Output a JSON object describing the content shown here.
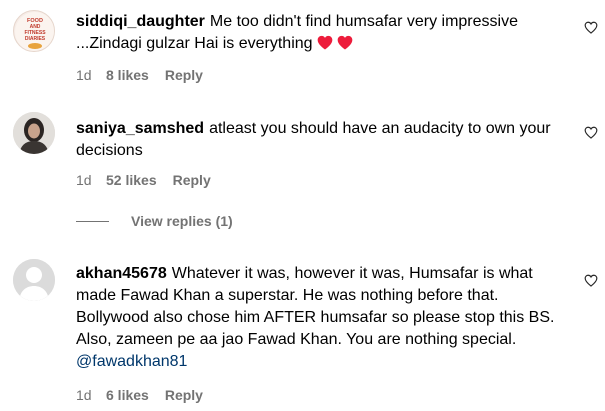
{
  "comments": [
    {
      "username": "siddiqi_daughter",
      "text": "Me too didn't find humsafar very impressive ...Zindagi gulzar Hai is everything",
      "hearts": 2,
      "time": "1d",
      "likes": "8 likes",
      "reply": "Reply",
      "avatar": "food-and-fitness-logo-avatar",
      "avatar_text": "FOOD AND FITNESS DIARIES"
    },
    {
      "username": "saniya_samshed",
      "text": "atleast you should have an audacity to own your decisions",
      "time": "1d",
      "likes": "52 likes",
      "reply": "Reply",
      "avatar": "profile-photo-avatar"
    },
    {
      "username": "akhan45678",
      "text": "Whatever it was, however it was, Humsafar is what made Fawad Khan a superstar. He was nothing before that. Bollywood also chose him AFTER humsafar so please stop this BS. Also, zameen pe aa jao Fawad Khan. You are nothing special.",
      "mention": "@fawadkhan81",
      "time": "1d",
      "likes": "6 likes",
      "reply": "Reply",
      "avatar": "default-avatar"
    }
  ],
  "view_replies": "View replies (1)",
  "colors": {
    "text": "#000000",
    "secondary": "#737373",
    "mention": "#00376b",
    "heart": "#ed4956"
  },
  "icons": {
    "like": "heart-outline-icon",
    "emoji": "red-heart-emoji"
  }
}
